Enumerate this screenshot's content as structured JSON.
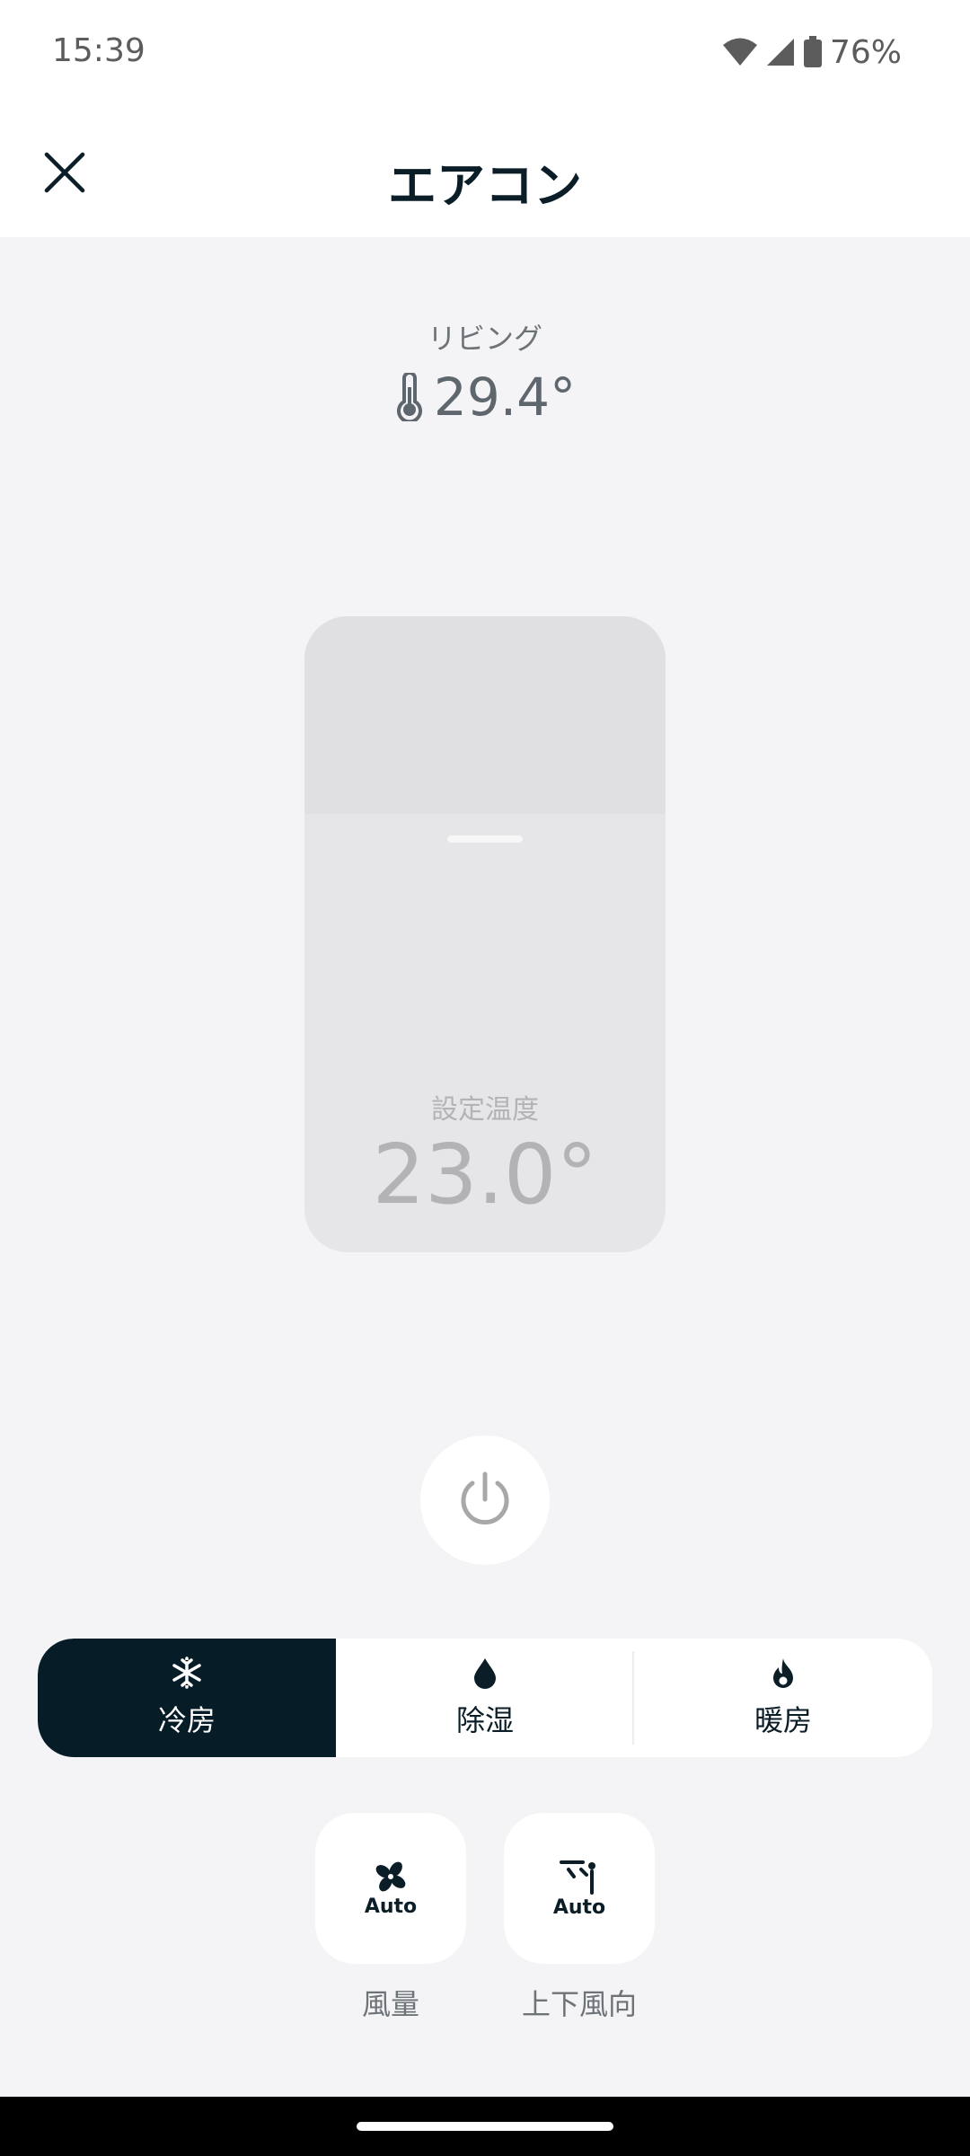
{
  "status_bar": {
    "time": "15:39",
    "battery": "76%",
    "icons": [
      "wifi-icon",
      "signal-icon",
      "battery-icon"
    ]
  },
  "header": {
    "title": "エアコン",
    "close_icon": "close-icon"
  },
  "room": {
    "name": "リビング",
    "current_temp": "29.4°",
    "icon": "thermometer-icon"
  },
  "setpoint": {
    "label": "設定温度",
    "value": "23.0°"
  },
  "power": {
    "icon": "power-icon"
  },
  "modes": [
    {
      "label": "冷房",
      "icon": "snowflake-icon",
      "active": true
    },
    {
      "label": "除湿",
      "icon": "droplet-icon",
      "active": false
    },
    {
      "label": "暖房",
      "icon": "flame-icon",
      "active": false
    }
  ],
  "controls": [
    {
      "label": "風量",
      "value": "Auto",
      "icon": "fan-icon"
    },
    {
      "label": "上下風向",
      "value": "Auto",
      "icon": "vane-icon"
    }
  ],
  "colors": {
    "accent_dark": "#061c26",
    "background": "#f4f4f6",
    "card": "#ffffff"
  }
}
